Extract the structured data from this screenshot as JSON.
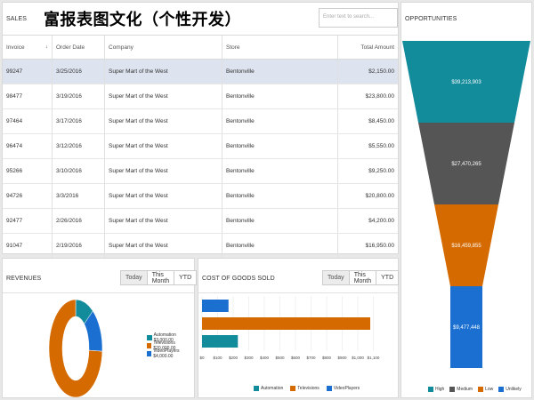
{
  "overlay_title": "富报表图文化（个性开发）",
  "sales": {
    "title": "SALES",
    "search_placeholder": "Enter text to search...",
    "columns": [
      "Invoice",
      "Order Date",
      "Company",
      "Store",
      "Total Amount"
    ],
    "rows": [
      [
        "99247",
        "3/25/2016",
        "Super Mart of the West",
        "Bentonville",
        "$2,150.00"
      ],
      [
        "98477",
        "3/19/2016",
        "Super Mart of the West",
        "Bentonville",
        "$23,800.00"
      ],
      [
        "97464",
        "3/17/2016",
        "Super Mart of the West",
        "Bentonville",
        "$8,450.00"
      ],
      [
        "96474",
        "3/12/2016",
        "Super Mart of the West",
        "Bentonville",
        "$5,550.00"
      ],
      [
        "95266",
        "3/10/2016",
        "Super Mart of the West",
        "Bentonville",
        "$9,250.00"
      ],
      [
        "94726",
        "3/3/2016",
        "Super Mart of the West",
        "Bentonville",
        "$20,800.00"
      ],
      [
        "92477",
        "2/26/2016",
        "Super Mart of the West",
        "Bentonville",
        "$4,200.00"
      ],
      [
        "91047",
        "2/19/2016",
        "Super Mart of the West",
        "Bentonville",
        "$16,950.00"
      ]
    ]
  },
  "opportunities": {
    "title": "OPPORTUNITIES",
    "legend": [
      "High",
      "Medium",
      "Low",
      "Unlikely"
    ]
  },
  "revenues": {
    "title": "REVENUES",
    "tabs": [
      "Today",
      "This Month",
      "YTD"
    ]
  },
  "cogs": {
    "title": "COST OF GOODS SOLD",
    "tabs": [
      "Today",
      "This Month",
      "YTD"
    ]
  },
  "colors": {
    "teal": "#128b9b",
    "gray": "#555555",
    "orange": "#d46a00",
    "blue": "#1a6fd1"
  },
  "chart_data": [
    {
      "type": "funnel",
      "categories": [
        "High",
        "Medium",
        "Low",
        "Unlikely"
      ],
      "values": [
        39213903,
        27470265,
        16459855,
        9477448
      ],
      "labels": [
        "$39,213,903",
        "$27,470,265",
        "$16,459,855",
        "$9,477,448"
      ]
    },
    {
      "type": "pie",
      "categories": [
        "Automation",
        "Televisions",
        "VideoPlayers"
      ],
      "values": [
        3000,
        20000,
        4000
      ],
      "legend": [
        "Automation $3,000.00",
        "Televisions $20,000.00",
        "VideoPlayers $4,000.00"
      ]
    },
    {
      "type": "bar",
      "categories": [
        "Automation",
        "Televisions",
        "VideoPlayers"
      ],
      "values": [
        230,
        1080,
        170
      ],
      "xlim": [
        0,
        1200
      ],
      "ticks": [
        "$0",
        "$100",
        "$200",
        "$300",
        "$400",
        "$500",
        "$600",
        "$700",
        "$800",
        "$900",
        "$1,000",
        "$1,100"
      ]
    }
  ]
}
